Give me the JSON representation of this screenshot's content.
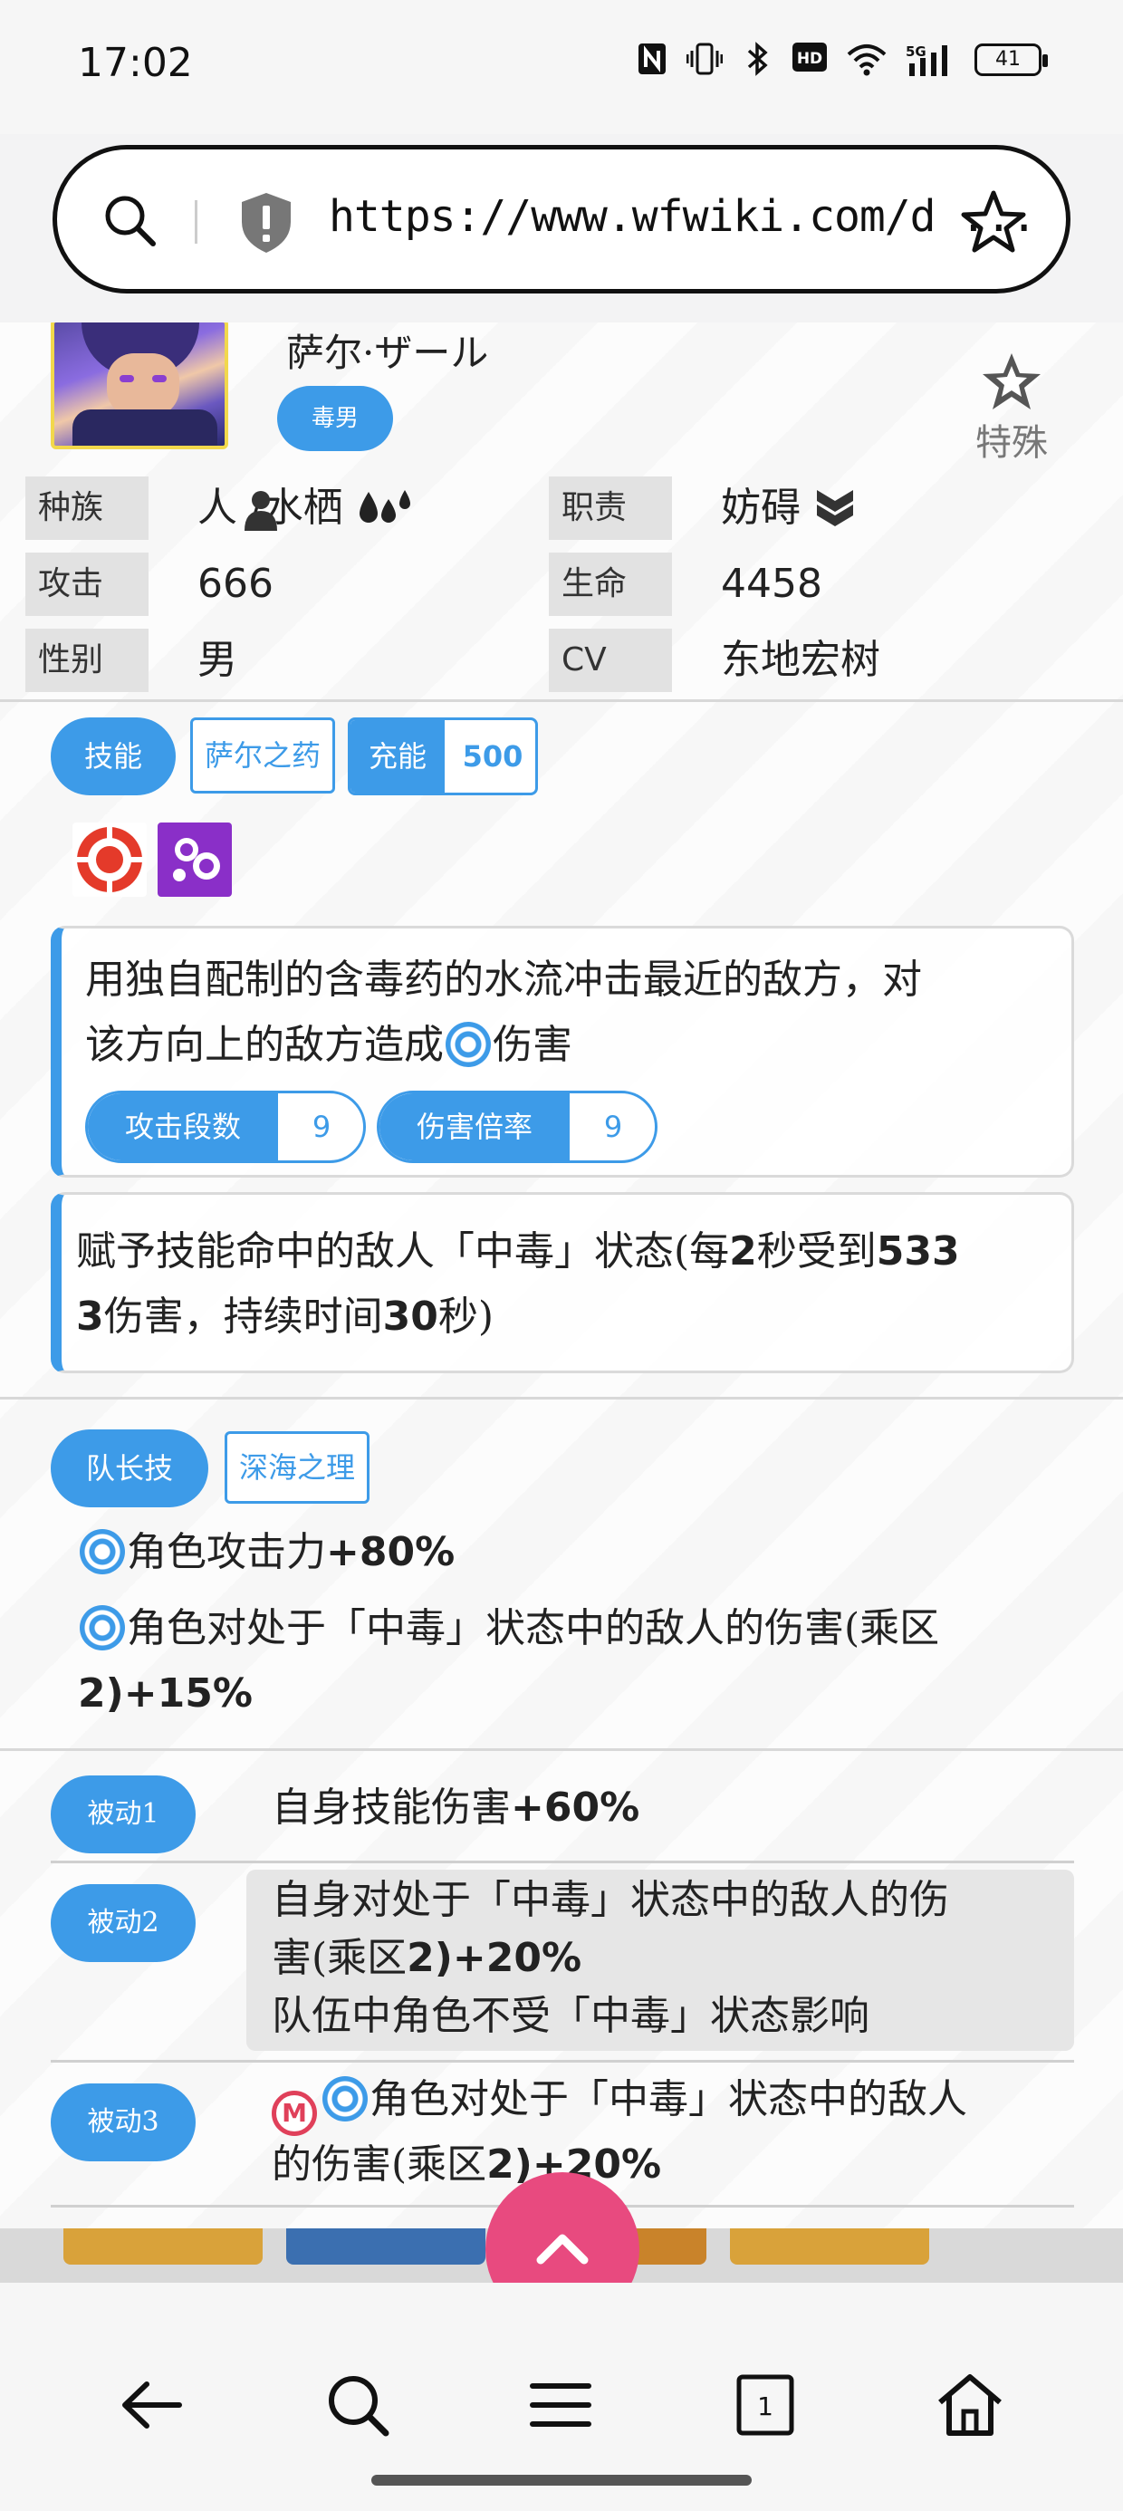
{
  "status_bar": {
    "time": "17:02",
    "icons": [
      "nfc-icon",
      "vibrate-icon",
      "bluetooth-icon",
      "hd-icon",
      "wifi-icon",
      "signal-5g-icon"
    ],
    "hd_label": "HD",
    "net_label": "5G",
    "battery": "41"
  },
  "browser": {
    "url": "https://www.wfwiki.com/d ..."
  },
  "character": {
    "name": "萨尔·ザール",
    "tag": "毒男",
    "rarity_label": "特殊",
    "stats": {
      "race_label": "种族",
      "race_value": "人 /水栖",
      "role_label": "职责",
      "role_value": "妨碍",
      "attack_label": "攻击",
      "attack_value": "666",
      "hp_label": "生命",
      "hp_value": "4458",
      "gender_label": "性别",
      "gender_value": "男",
      "cv_label": "CV",
      "cv_value": "东地宏树"
    }
  },
  "skill": {
    "pill": "技能",
    "name": "萨尔之药",
    "charge_label": "充能",
    "charge_value": "500",
    "desc_1_a": "用独自配制的含毒药的水流冲击最近的敌方，对",
    "desc_1_b": "该方向上的敌方造成",
    "desc_1_c": "伤害",
    "hits_label": "攻击段数",
    "hits_value": "9",
    "mult_label": "伤害倍率",
    "mult_value": "9",
    "desc_2_a": "赋予技能命中的敌人「中毒」状态(每",
    "desc_2_b": "2",
    "desc_2_c": "秒受到",
    "desc_2_d": "533",
    "desc_2_e": "3",
    "desc_2_f": "伤害，持续时间",
    "desc_2_g": "30",
    "desc_2_h": "秒)"
  },
  "leader": {
    "pill": "队长技",
    "name": "深海之理",
    "line_1_a": "角色攻击力",
    "line_1_b": "+80%",
    "line_2_a": "角色对处于「中毒」状态中的敌人的伤害(乘区",
    "line_2_b": "2)+15%"
  },
  "passives": [
    {
      "pill": "被动1",
      "text": "自身技能伤害",
      "value": "+60%"
    },
    {
      "pill": "被动2",
      "text_a": "自身对处于「中毒」状态中的敌人的伤",
      "text_b": "害(乘区",
      "value": "2)+20%",
      "text_c": "队伍中角色不受「中毒」状态影响"
    },
    {
      "pill": "被动3",
      "text_a": "角色对处于「中毒」状态中的敌人",
      "text_b": "的伤害(乘区",
      "value": "2)+20%",
      "m_label": "M"
    }
  ],
  "nav": {
    "items": [
      "back-arrow-icon",
      "search-icon",
      "menu-icon",
      "tabs-icon",
      "home-icon"
    ],
    "tab_count": "1"
  },
  "colors": {
    "accent": "#3d9be8",
    "fab": "#e84a7f"
  }
}
